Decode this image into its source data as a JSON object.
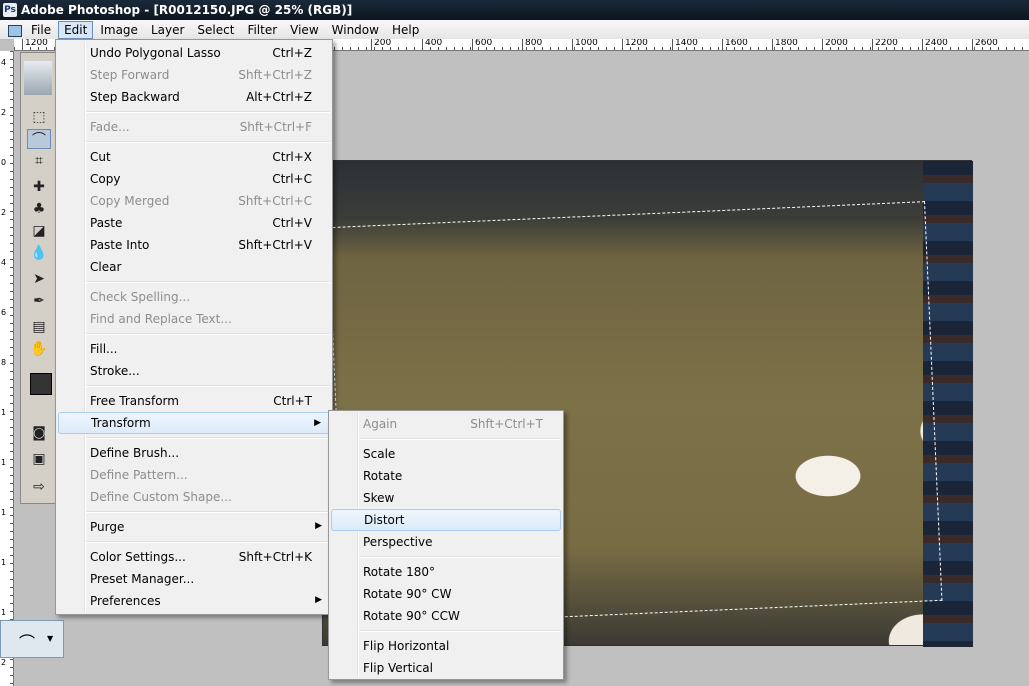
{
  "window": {
    "title": "Adobe Photoshop - [R0012150.JPG @ 25% (RGB)]"
  },
  "menubar": [
    "File",
    "Edit",
    "Image",
    "Layer",
    "Select",
    "Filter",
    "View",
    "Window",
    "Help"
  ],
  "active_menu": "Edit",
  "ruler_top": [
    "1200",
    "200",
    "400",
    "600",
    "800",
    "1000",
    "1200",
    "1400",
    "1600",
    "1800",
    "2000",
    "2200",
    "2400",
    "2600"
  ],
  "ruler_left": [
    "4",
    "2",
    "0",
    "2",
    "4",
    "6",
    "8",
    "1",
    "1",
    "1",
    "1",
    "1",
    "2"
  ],
  "edit_menu": {
    "undo": {
      "label": "Undo Polygonal Lasso",
      "shortcut": "Ctrl+Z"
    },
    "step_forward": {
      "label": "Step Forward",
      "shortcut": "Shft+Ctrl+Z"
    },
    "step_backward": {
      "label": "Step Backward",
      "shortcut": "Alt+Ctrl+Z"
    },
    "fade": {
      "label": "Fade...",
      "shortcut": "Shft+Ctrl+F"
    },
    "cut": {
      "label": "Cut",
      "shortcut": "Ctrl+X"
    },
    "copy": {
      "label": "Copy",
      "shortcut": "Ctrl+C"
    },
    "copy_merged": {
      "label": "Copy Merged",
      "shortcut": "Shft+Ctrl+C"
    },
    "paste": {
      "label": "Paste",
      "shortcut": "Ctrl+V"
    },
    "paste_into": {
      "label": "Paste Into",
      "shortcut": "Shft+Ctrl+V"
    },
    "clear": {
      "label": "Clear"
    },
    "check_spelling": {
      "label": "Check Spelling..."
    },
    "find_replace": {
      "label": "Find and Replace Text..."
    },
    "fill": {
      "label": "Fill..."
    },
    "stroke": {
      "label": "Stroke..."
    },
    "free_transform": {
      "label": "Free Transform",
      "shortcut": "Ctrl+T"
    },
    "transform": {
      "label": "Transform"
    },
    "define_brush": {
      "label": "Define Brush..."
    },
    "define_pattern": {
      "label": "Define Pattern..."
    },
    "define_custom_shape": {
      "label": "Define Custom Shape..."
    },
    "purge": {
      "label": "Purge"
    },
    "color_settings": {
      "label": "Color Settings...",
      "shortcut": "Shft+Ctrl+K"
    },
    "preset_manager": {
      "label": "Preset Manager..."
    },
    "preferences": {
      "label": "Preferences"
    }
  },
  "transform_menu": {
    "again": {
      "label": "Again",
      "shortcut": "Shft+Ctrl+T"
    },
    "scale": "Scale",
    "rotate": "Rotate",
    "skew": "Skew",
    "distort": "Distort",
    "perspective": "Perspective",
    "rotate180": "Rotate 180°",
    "rotate90cw": "Rotate 90° CW",
    "rotate90ccw": "Rotate 90° CCW",
    "flip_h": "Flip Horizontal",
    "flip_v": "Flip Vertical"
  },
  "highlighted_items": [
    "Transform",
    "Distort"
  ],
  "icons": {
    "app": "photoshop-icon",
    "submenu": "▶",
    "marquee": "⬚",
    "lasso": "⌒",
    "crop": "⌗",
    "heal": "✚",
    "stamp": "♣",
    "eraser": "◪",
    "blur": "💧",
    "select": "➤",
    "pen": "✒",
    "notes": "▤",
    "hand": "✋",
    "quickmask": "◙",
    "screen": "▣",
    "jump": "⇨"
  },
  "colors": {
    "menu_bg": "#f0f0f0",
    "highlight": "#dcebfa",
    "title_bg": "#0d1620"
  }
}
